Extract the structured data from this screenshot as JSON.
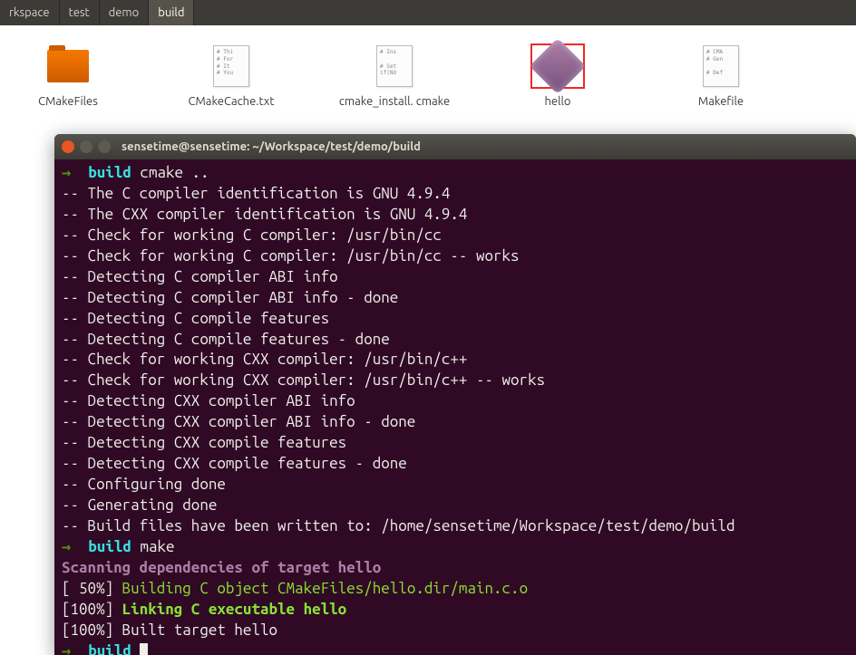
{
  "breadcrumb": {
    "items": [
      {
        "label": "rkspace"
      },
      {
        "label": "test"
      },
      {
        "label": "demo"
      },
      {
        "label": "build"
      }
    ],
    "activeIndex": 3
  },
  "files": [
    {
      "name": "CMakeFiles",
      "type": "folder",
      "preview": ""
    },
    {
      "name": "CMakeCache.txt",
      "type": "text",
      "preview": "# Thi\n# For\n# It\n# You"
    },
    {
      "name": "cmake_install.\ncmake",
      "type": "text",
      "preview": "# Ins\n\n# Set\nif(NO"
    },
    {
      "name": "hello",
      "type": "exec",
      "preview": ""
    },
    {
      "name": "Makefile",
      "type": "text",
      "preview": "# CMA\n# Gen\n\n# Def"
    }
  ],
  "selectedFileIndex": 3,
  "terminal": {
    "title": "sensetime@sensetime: ~/Workspace/test/demo/build",
    "prompt1_dir": "build",
    "prompt1_cmd": "cmake ..",
    "lines": [
      "-- The C compiler identification is GNU 4.9.4",
      "-- The CXX compiler identification is GNU 4.9.4",
      "-- Check for working C compiler: /usr/bin/cc",
      "-- Check for working C compiler: /usr/bin/cc -- works",
      "-- Detecting C compiler ABI info",
      "-- Detecting C compiler ABI info - done",
      "-- Detecting C compile features",
      "-- Detecting C compile features - done",
      "-- Check for working CXX compiler: /usr/bin/c++",
      "-- Check for working CXX compiler: /usr/bin/c++ -- works",
      "-- Detecting CXX compiler ABI info",
      "-- Detecting CXX compiler ABI info - done",
      "-- Detecting CXX compile features",
      "-- Detecting CXX compile features - done",
      "-- Configuring done",
      "-- Generating done",
      "-- Build files have been written to: /home/sensetime/Workspace/test/demo/build"
    ],
    "prompt2_dir": "build",
    "prompt2_cmd": "make",
    "scan_line": "Scanning dependencies of target hello",
    "pct50": "[ 50%]",
    "build_obj": "Building C object CMakeFiles/hello.dir/main.c.o",
    "pct100a": "[100%]",
    "link_line": "Linking C executable hello",
    "pct100b": "[100%]",
    "built_line": "Built target hello",
    "prompt3_dir": "build"
  }
}
